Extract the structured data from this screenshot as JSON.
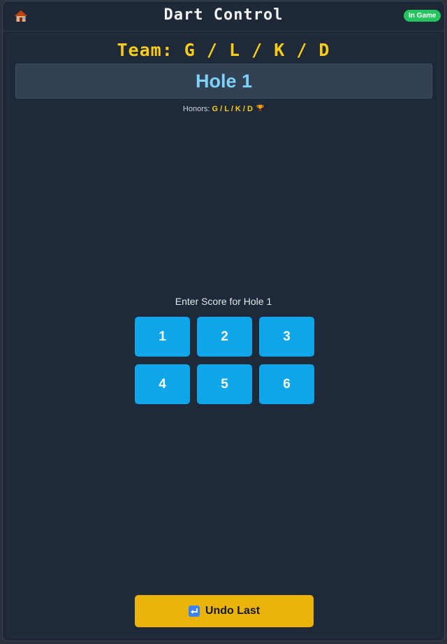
{
  "header": {
    "title": "Dart Control",
    "status_badge": "In Game",
    "home_icon": "home-icon"
  },
  "game": {
    "team_line": "Team: G / L / K / D",
    "hole_title": "Hole 1",
    "honors_label": "Honors:",
    "honors_value": "G / L / K / D",
    "trophy_icon": "trophy-icon",
    "score_prompt": "Enter Score for Hole 1",
    "score_buttons": [
      "1",
      "2",
      "3",
      "4",
      "5",
      "6"
    ]
  },
  "actions": {
    "undo_label": "Undo Last",
    "undo_icon": "undo-icon"
  },
  "colors": {
    "accent_blue": "#0ea5e9",
    "accent_yellow": "#eab308",
    "status_green": "#22c55e",
    "title_blue": "#7dd3fc"
  }
}
